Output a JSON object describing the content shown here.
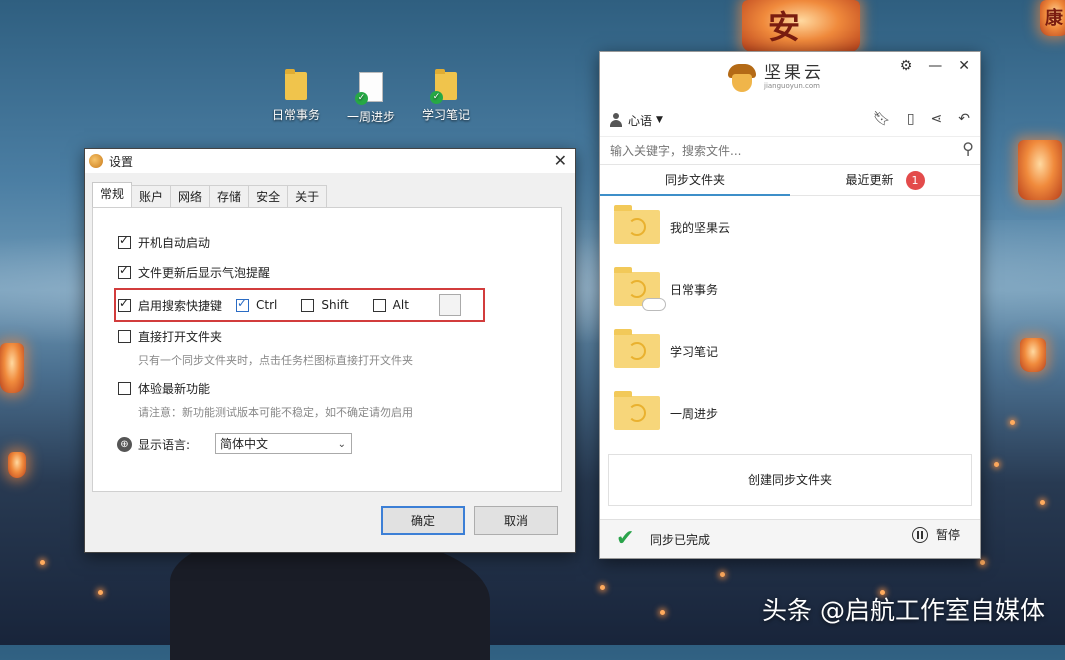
{
  "desktop": {
    "icons": [
      {
        "label": "日常事务",
        "icon": "folder-icon"
      },
      {
        "label": "一周进步",
        "icon": "synced-document-icon"
      },
      {
        "label": "学习笔记",
        "icon": "synced-folder-icon"
      }
    ],
    "watermark": "头条 @启航工作室自媒体",
    "lantern_text": [
      "安",
      "康"
    ]
  },
  "settings": {
    "title": "设置",
    "close": "✕",
    "tabs": [
      "常规",
      "账户",
      "网络",
      "存储",
      "安全",
      "关于"
    ],
    "active_tab": "常规",
    "options": {
      "autostart": {
        "label": "开机自动启动",
        "checked": true
      },
      "bubble": {
        "label": "文件更新后显示气泡提醒",
        "checked": true
      },
      "search_hotkey": {
        "label": "启用搜索快捷键",
        "checked": true
      },
      "ctrl": {
        "label": "Ctrl",
        "checked": true
      },
      "shift": {
        "label": "Shift",
        "checked": false
      },
      "alt": {
        "label": "Alt",
        "checked": false
      },
      "open_folder": {
        "label": "直接打开文件夹",
        "checked": false,
        "hint": "只有一个同步文件夹时，点击任务栏图标直接打开文件夹"
      },
      "beta": {
        "label": "体验最新功能",
        "checked": false,
        "hint": "请注意：新功能测试版本可能不稳定，如不确定请勿启用"
      }
    },
    "language": {
      "label": "显示语言:",
      "value": "简体中文"
    },
    "ok": "确定",
    "cancel": "取消"
  },
  "nutstore": {
    "brand": "坚果云",
    "brand_sub": "jianguoyun.com",
    "window_controls": [
      "⚙",
      "—",
      "✕"
    ],
    "user": "心语",
    "toolbar_icons": [
      "bookmark-icon",
      "tablet-icon",
      "share-icon",
      "undo-icon"
    ],
    "search_placeholder": "输入关键字，搜索文件...",
    "tabs": {
      "synced": "同步文件夹",
      "recent": "最近更新",
      "recent_badge": "1"
    },
    "active_tab": "synced",
    "folders": [
      "我的坚果云",
      "日常事务",
      "学习笔记",
      "一周进步"
    ],
    "create_button": "创建同步文件夹",
    "status": "同步已完成",
    "pause": "暂停",
    "colors": {
      "accent": "#3d8fc9",
      "badge": "#e34b4b",
      "ok": "#2aa34a"
    }
  }
}
